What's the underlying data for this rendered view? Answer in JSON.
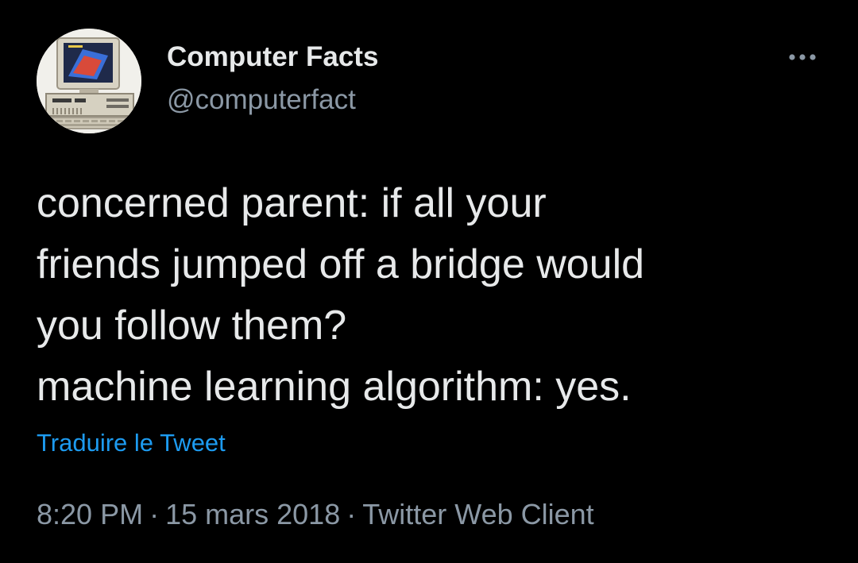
{
  "author": {
    "display_name": "Computer Facts",
    "handle": "@computerfact",
    "avatar_icon": "retro-computer-avatar"
  },
  "more_icon": "more-options-icon",
  "tweet": {
    "lines": [
      "concerned parent: if all your",
      "friends jumped off a bridge would",
      "you follow them?",
      "machine learning algorithm: yes."
    ]
  },
  "translate_label": "Traduire le Tweet",
  "meta": {
    "time": "8:20 PM",
    "separator": "·",
    "date": "15 mars 2018",
    "client": "Twitter Web Client"
  },
  "colors": {
    "background": "#000000",
    "text": "#e7e9ea",
    "secondary": "#8b98a5",
    "link": "#1d9bf0"
  }
}
